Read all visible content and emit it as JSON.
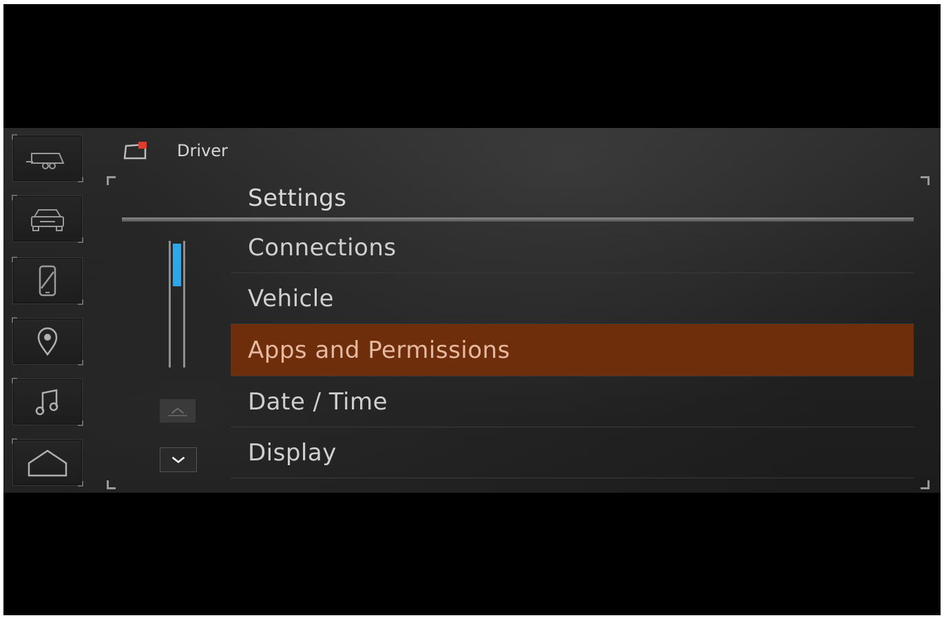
{
  "header": {
    "profile_label": "Driver",
    "profile_icon": "driver-profile-icon"
  },
  "rail": {
    "items": [
      {
        "icon": "trailer-icon"
      },
      {
        "icon": "vehicle-icon"
      },
      {
        "icon": "phone-icon"
      },
      {
        "icon": "navigation-pin-icon"
      },
      {
        "icon": "music-icon"
      },
      {
        "icon": "home-icon"
      }
    ]
  },
  "settings": {
    "title": "Settings",
    "items": [
      {
        "label": "Connections"
      },
      {
        "label": "Vehicle"
      },
      {
        "label": "Apps and Permissions",
        "selected": true
      },
      {
        "label": "Date / Time"
      },
      {
        "label": "Display"
      }
    ]
  },
  "colors": {
    "selected_background": "#6e2e0c",
    "scroll_thumb": "#2ea6ea"
  }
}
